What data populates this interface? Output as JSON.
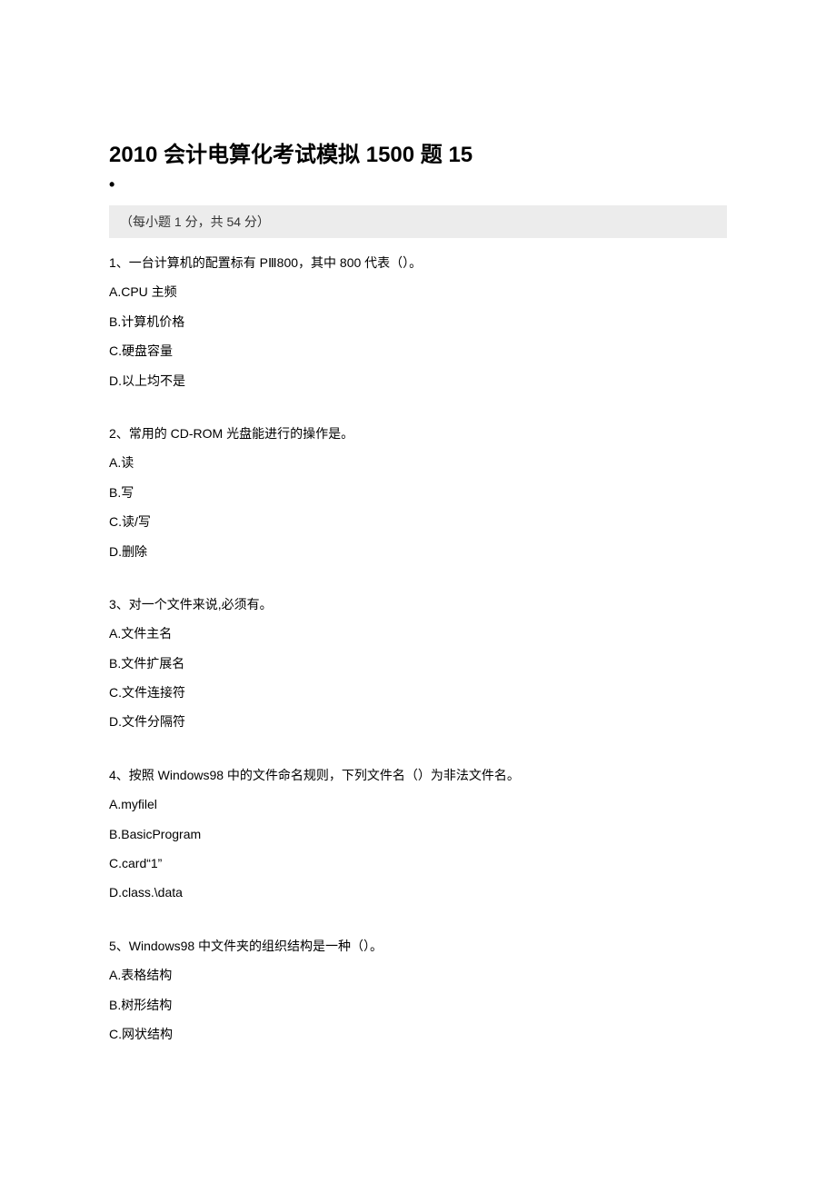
{
  "title": "2010 会计电算化考试模拟 1500 题 15",
  "bullet": "•",
  "instruction": "（每小题 1 分，共 54 分）",
  "questions": [
    {
      "text": "1、一台计算机的配置标有 PⅢ800，其中 800 代表（）。",
      "options": [
        "A.CPU 主频",
        "B.计算机价格",
        "C.硬盘容量",
        "D.以上均不是"
      ]
    },
    {
      "text": "2、常用的 CD-ROM 光盘能进行的操作是。",
      "options": [
        "A.读",
        "B.写",
        "C.读/写",
        "D.删除"
      ]
    },
    {
      "text": "3、对一个文件来说,必须有。",
      "options": [
        "A.文件主名",
        "B.文件扩展名",
        "C.文件连接符",
        "D.文件分隔符"
      ]
    },
    {
      "text": "4、按照 Windows98 中的文件命名规则，下列文件名（）为非法文件名。",
      "options": [
        "A.myfilel",
        "B.BasicProgram",
        "C.card“1”",
        "D.class.\\data"
      ]
    },
    {
      "text": "5、Windows98 中文件夹的组织结构是一种（）。",
      "options": [
        "A.表格结构",
        "B.树形结构",
        "C.网状结构"
      ]
    }
  ]
}
